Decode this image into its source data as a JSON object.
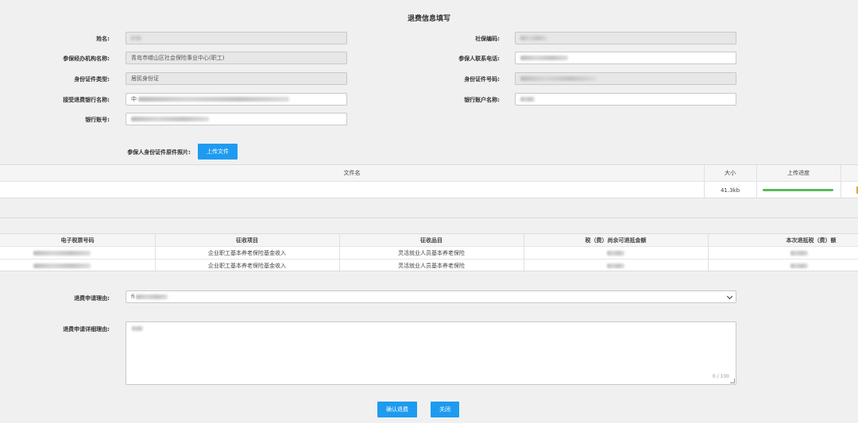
{
  "page": {
    "title": "退费信息填写"
  },
  "form": {
    "name_label": "姓名:",
    "social_code_label": "社保编码:",
    "agency_label": "参保经办机构名称:",
    "agency_value": "青岛市崂山区社会保险事业中心(职工)",
    "phone_label": "参保人联系电话:",
    "id_type_label": "身份证件类型:",
    "id_type_value": "居民身份证",
    "id_no_label": "身份证件号码:",
    "bank_label": "接受退费银行名称:",
    "bank_value_prefix": "中",
    "account_name_label": "银行账户名称:",
    "account_no_label": "银行账号:"
  },
  "upload": {
    "label": "参保人身份证件原件照片:",
    "button": "上传文件",
    "columns": {
      "name": "文件名",
      "size": "大小",
      "progress": "上传进度"
    },
    "file": {
      "size": "41.3kb",
      "progress": 1.0
    }
  },
  "tax_table": {
    "headers": [
      "电子税票号码",
      "征收项目",
      "征收品目",
      "税（费）尚余可退抵金额",
      "本次退抵税（费）额"
    ],
    "rows": [
      {
        "item": "企业职工基本养老保险基金收入",
        "category": "灵活就业人员基本养老保险"
      },
      {
        "item": "企业职工基本养老保险基金收入",
        "category": "灵活就业人员基本养老保险"
      }
    ]
  },
  "reason": {
    "label": "退费申请理由:",
    "selected_prefix": "fi"
  },
  "detail": {
    "label": "退费申请详细理由:",
    "counter": "0 / 100"
  },
  "actions": {
    "confirm": "确认退费",
    "close": "关闭"
  },
  "colors": {
    "accent": "#1e9bf0",
    "progress": "#5cb85c"
  }
}
